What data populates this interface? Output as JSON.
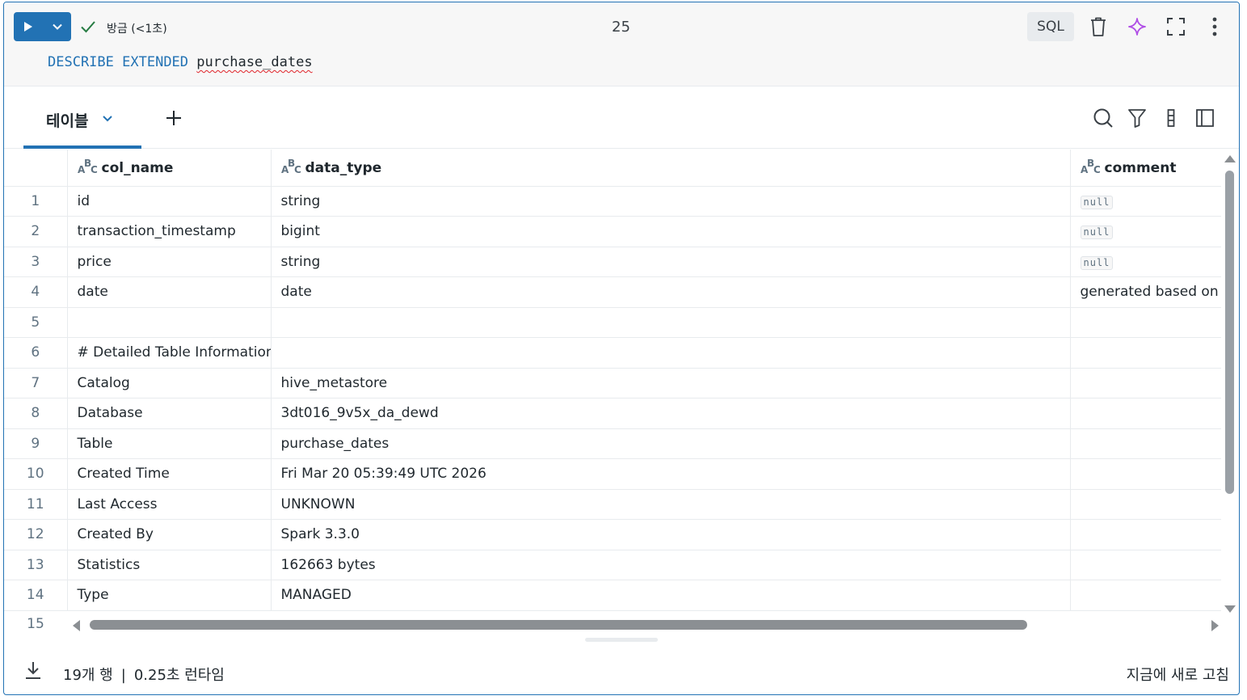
{
  "header": {
    "run_label": "Run",
    "status": "방금 (<1초)",
    "cell_number": "25",
    "language": "SQL"
  },
  "code": {
    "keyword1": "DESCRIBE",
    "keyword2": "EXTENDED",
    "table": "purchase_dates"
  },
  "results": {
    "tab_label": "테이블",
    "columns": [
      "col_name",
      "data_type",
      "comment"
    ],
    "rows": [
      {
        "index": "1",
        "col_name": "id",
        "data_type": "string",
        "comment": "null"
      },
      {
        "index": "2",
        "col_name": "transaction_timestamp",
        "data_type": "bigint",
        "comment": "null"
      },
      {
        "index": "3",
        "col_name": "price",
        "data_type": "string",
        "comment": "null"
      },
      {
        "index": "4",
        "col_name": "date",
        "data_type": "date",
        "comment": "generated based on `t"
      },
      {
        "index": "5",
        "col_name": "",
        "data_type": "",
        "comment": ""
      },
      {
        "index": "6",
        "col_name": "# Detailed Table Information",
        "data_type": "",
        "comment": ""
      },
      {
        "index": "7",
        "col_name": "Catalog",
        "data_type": "hive_metastore",
        "comment": ""
      },
      {
        "index": "8",
        "col_name": "Database",
        "data_type": "3dt016_9v5x_da_dewd",
        "comment": ""
      },
      {
        "index": "9",
        "col_name": "Table",
        "data_type": "purchase_dates",
        "comment": ""
      },
      {
        "index": "10",
        "col_name": "Created Time",
        "data_type": "Fri Mar 20 05:39:49 UTC 2026",
        "comment": ""
      },
      {
        "index": "11",
        "col_name": "Last Access",
        "data_type": "UNKNOWN",
        "comment": ""
      },
      {
        "index": "12",
        "col_name": "Created By",
        "data_type": "Spark 3.3.0",
        "comment": ""
      },
      {
        "index": "13",
        "col_name": "Statistics",
        "data_type": "162663 bytes",
        "comment": ""
      },
      {
        "index": "14",
        "col_name": "Type",
        "data_type": "MANAGED",
        "comment": ""
      }
    ],
    "partial_row_index": "15"
  },
  "footer": {
    "row_count": "19개 행",
    "runtime": "0.25초 런타임",
    "refresh": "지금에 새로 고침"
  },
  "colors": {
    "accent": "#2272b4",
    "check": "#277c43",
    "assistant": "#b04ee6",
    "error_underline": "#e0242a"
  }
}
